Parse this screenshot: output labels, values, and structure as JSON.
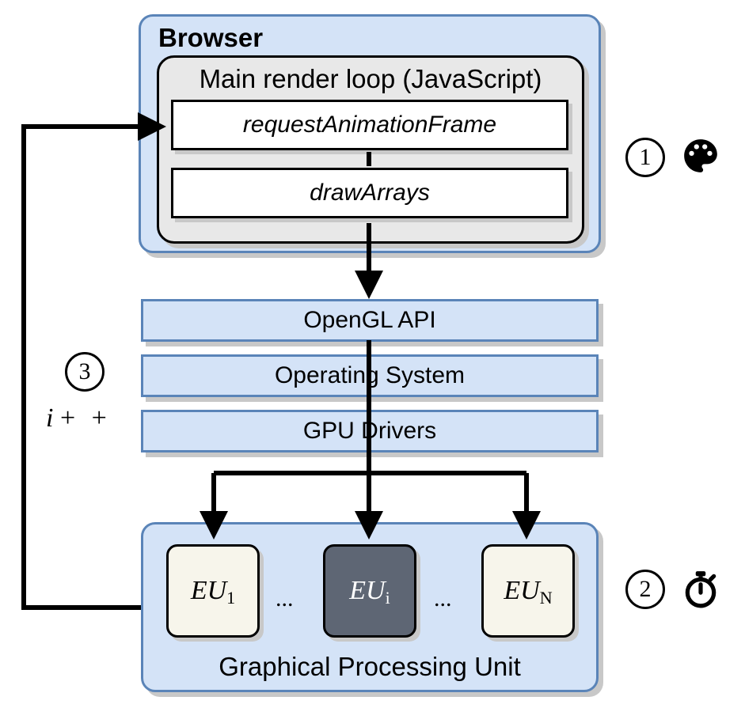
{
  "browser": {
    "title": "Browser",
    "render_loop": {
      "title": "Main render loop (JavaScript)",
      "calls": {
        "raf": "requestAnimationFrame",
        "draw": "drawArrays"
      }
    }
  },
  "layers": {
    "opengl": "OpenGL API",
    "os": "Operating System",
    "drivers": "GPU Drivers"
  },
  "gpu": {
    "title": "Graphical Processing Unit",
    "eu1_base": "EU",
    "eu1_sub": "1",
    "eui_base": "EU",
    "eui_sub": "i",
    "eun_base": "EU",
    "eun_sub": "N",
    "dots": "..."
  },
  "steps": {
    "one": "1",
    "two": "2",
    "three": "3",
    "ipp_i": "i",
    "ipp_plus": "+ +"
  },
  "icons": {
    "palette": "palette-icon",
    "stopwatch": "stopwatch-icon"
  }
}
